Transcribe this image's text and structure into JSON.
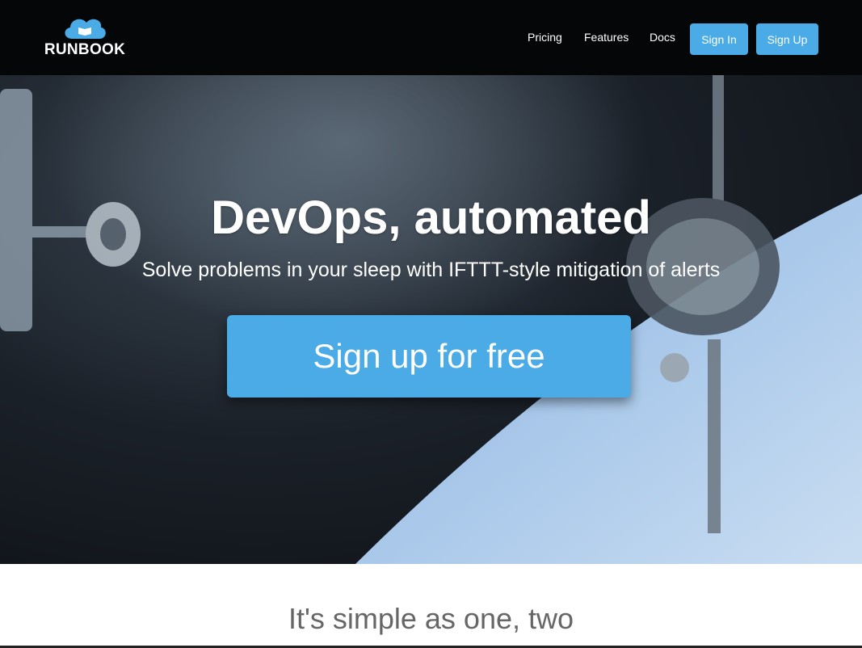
{
  "brand": {
    "name": "RUNBOOK",
    "logo_icon": "cloud-book-icon"
  },
  "nav": {
    "links": [
      "Pricing",
      "Features",
      "Docs"
    ],
    "signin_label": "Sign In",
    "signup_label": "Sign Up"
  },
  "hero": {
    "title": "DevOps, automated",
    "subtitle": "Solve problems in your sleep with IFTTT-style mitigation of alerts",
    "cta_label": "Sign up for free"
  },
  "section": {
    "title": "It's simple as one, two"
  },
  "colors": {
    "accent": "#4aabe6",
    "navbar": "#050608",
    "earth": "#9cbfe6"
  }
}
